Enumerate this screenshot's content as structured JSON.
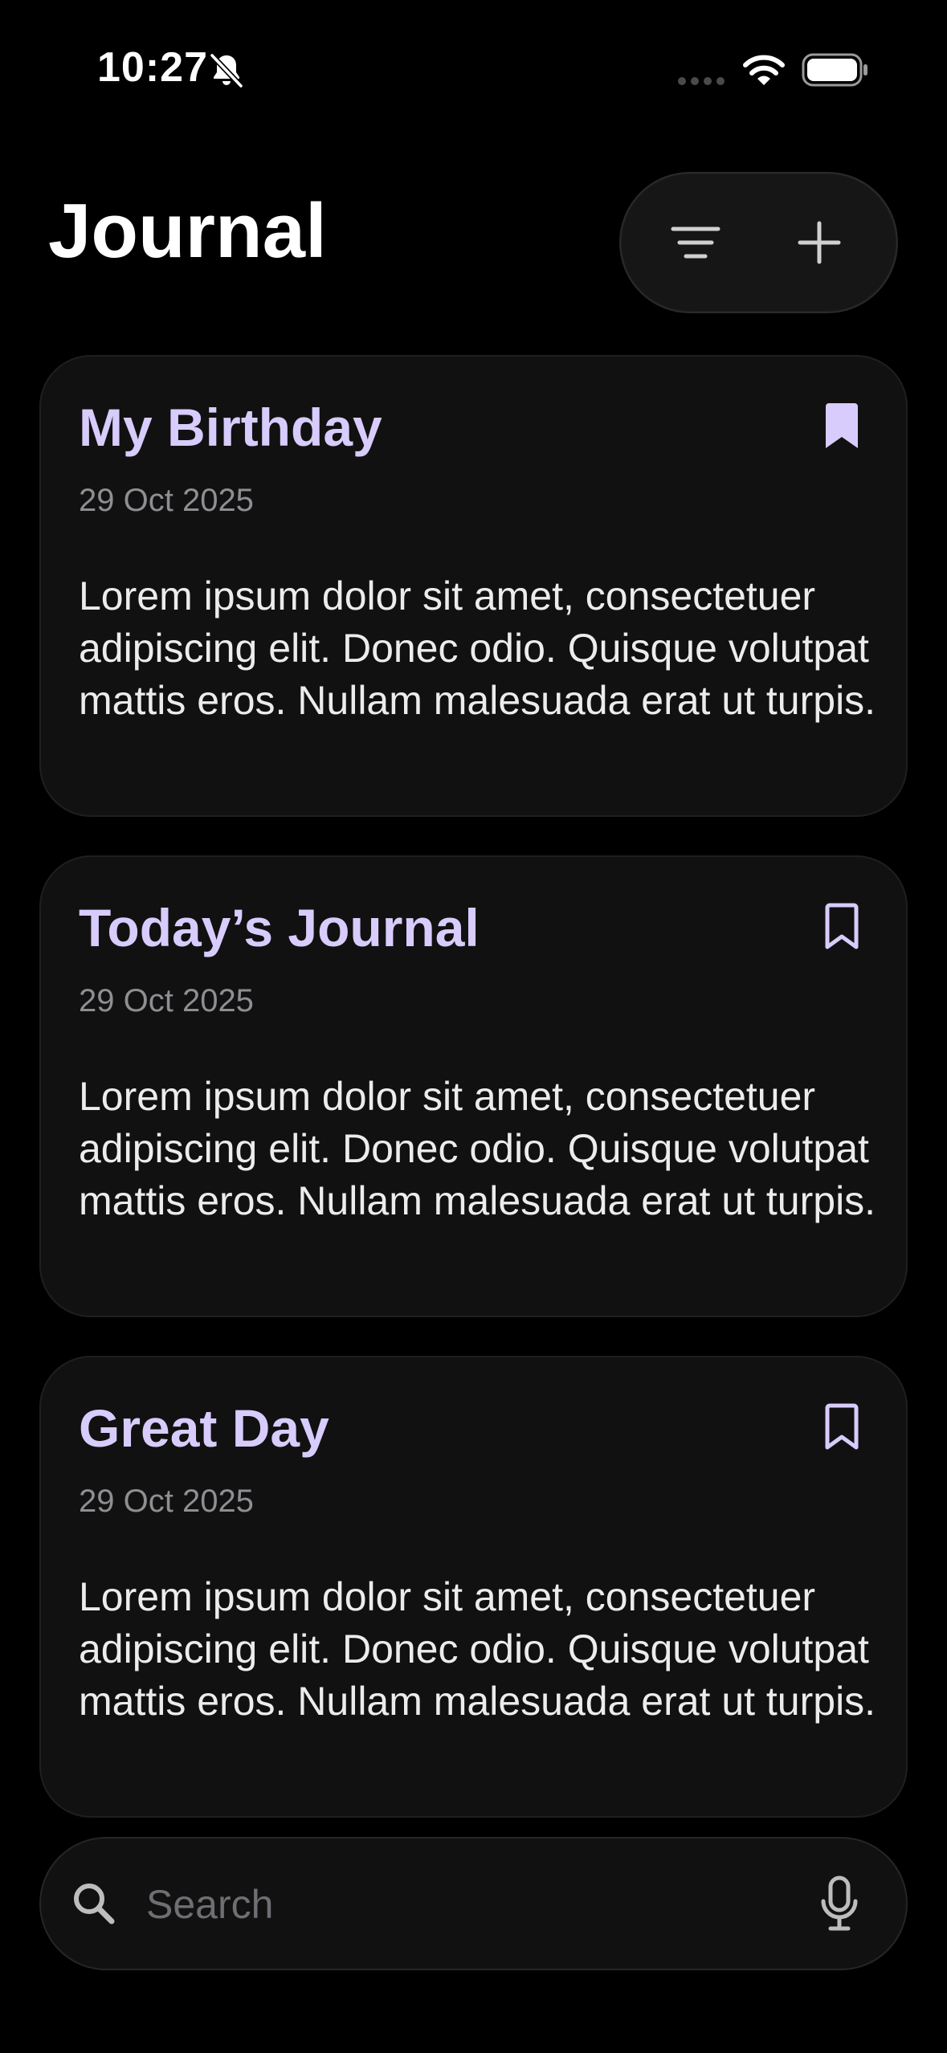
{
  "status_bar": {
    "time": "10:27"
  },
  "header": {
    "title": "Journal"
  },
  "entries": [
    {
      "title": "My Birthday",
      "date": "29 Oct 2025",
      "body": "Lorem ipsum dolor sit amet, consectetuer adipiscing elit. Donec odio. Quisque volutpat mattis eros. Nullam malesuada erat ut turpis.",
      "bookmarked": true
    },
    {
      "title": "Today’s Journal",
      "date": "29 Oct 2025",
      "body": "Lorem ipsum dolor sit amet, consectetuer adipiscing elit. Donec odio. Quisque volutpat mattis eros. Nullam malesuada erat ut turpis.",
      "bookmarked": false
    },
    {
      "title": "Great Day",
      "date": "29 Oct 2025",
      "body": "Lorem ipsum dolor sit amet, consectetuer adipiscing elit. Donec odio. Quisque volutpat mattis eros. Nullam malesuada erat ut turpis.",
      "bookmarked": false
    }
  ],
  "search": {
    "placeholder": "Search"
  },
  "icons": {
    "status": [
      "bell-slash-icon",
      "cellular-signal-icon",
      "wifi-icon",
      "battery-icon"
    ],
    "header": [
      "filter-icon",
      "plus-icon"
    ],
    "entry": "bookmark-icon",
    "search": [
      "search-icon",
      "microphone-icon"
    ]
  },
  "colors": {
    "background": "#000000",
    "card": "#111111",
    "accent": "#d7ccfb",
    "secondary_text": "#8e8e93",
    "body_text": "#ececec"
  }
}
